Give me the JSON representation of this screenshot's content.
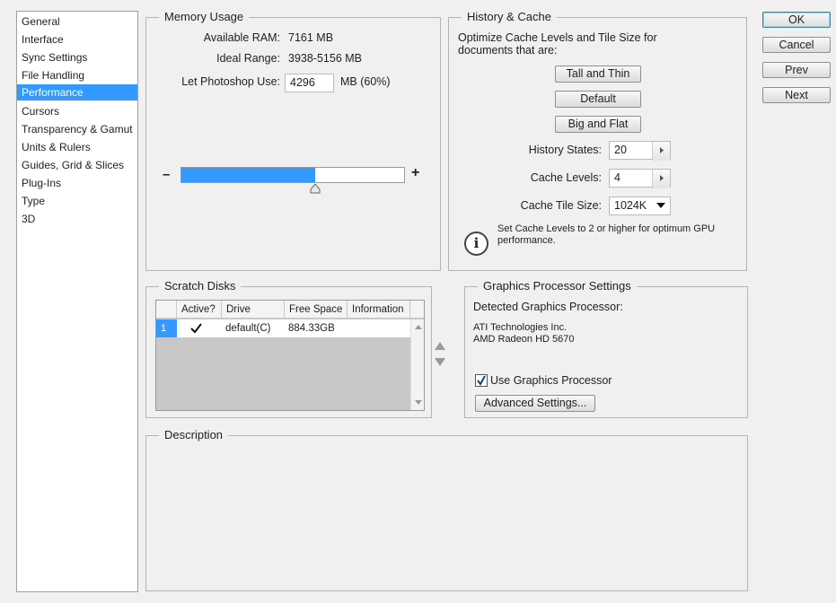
{
  "sidebar": {
    "items": [
      {
        "label": "General"
      },
      {
        "label": "Interface"
      },
      {
        "label": "Sync Settings"
      },
      {
        "label": "File Handling"
      },
      {
        "label": "Performance"
      },
      {
        "label": "Cursors"
      },
      {
        "label": "Transparency & Gamut"
      },
      {
        "label": "Units & Rulers"
      },
      {
        "label": "Guides, Grid & Slices"
      },
      {
        "label": "Plug-Ins"
      },
      {
        "label": "Type"
      },
      {
        "label": "3D"
      }
    ],
    "selected": "Performance"
  },
  "memory": {
    "title": "Memory Usage",
    "available_label": "Available RAM:",
    "available_value": "7161 MB",
    "ideal_label": "Ideal Range:",
    "ideal_value": "3938-5156 MB",
    "let_label": "Let Photoshop Use:",
    "let_value": "4296",
    "let_unit": "MB (60%)",
    "minus": "–",
    "plus": "+",
    "slider_fraction": 0.6
  },
  "history": {
    "title": "History & Cache",
    "intro": "Optimize Cache Levels and Tile Size for documents that are:",
    "btn_tall": "Tall and Thin",
    "btn_default": "Default",
    "btn_big": "Big and Flat",
    "states_label": "History States:",
    "states_value": "20",
    "levels_label": "Cache Levels:",
    "levels_value": "4",
    "tile_label": "Cache Tile Size:",
    "tile_value": "1024K",
    "info_icon": "i",
    "info_text": "Set Cache Levels to 2 or higher for optimum GPU performance."
  },
  "scratch": {
    "title": "Scratch Disks",
    "headers": [
      "Active?",
      "Drive",
      "Free Space",
      "Information"
    ],
    "rows": [
      {
        "num": "1",
        "active": true,
        "drive": "default(C)",
        "free": "884.33GB",
        "info": ""
      }
    ]
  },
  "gpu": {
    "title": "Graphics Processor Settings",
    "detected_label": "Detected Graphics Processor:",
    "vendor": "ATI Technologies Inc.",
    "model": "AMD Radeon HD 5670",
    "use_label": "Use Graphics Processor",
    "use_checked": true,
    "advanced_btn": "Advanced Settings..."
  },
  "description": {
    "title": "Description"
  },
  "buttons": {
    "ok": "OK",
    "cancel": "Cancel",
    "prev": "Prev",
    "next": "Next"
  },
  "colors": {
    "selection": "#3399ff",
    "slider_fill": "#3399ff"
  }
}
